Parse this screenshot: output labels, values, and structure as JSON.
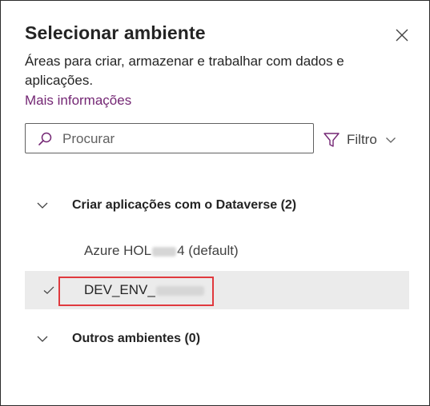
{
  "dialog": {
    "title": "Selecionar ambiente",
    "description": "Áreas para criar, armazenar e trabalhar com dados e aplicações.",
    "more_info_link": "Mais informações",
    "close_icon": "close-icon"
  },
  "search": {
    "placeholder": "Procurar",
    "value": "",
    "icon": "search-icon"
  },
  "filter": {
    "label": "Filtro",
    "icon": "filter-icon"
  },
  "groups": [
    {
      "label": "Criar aplicações com o Dataverse (2)",
      "expanded": true,
      "items": [
        {
          "name_prefix": "Azure HOL",
          "name_suffix": "4 (default)",
          "selected": false
        },
        {
          "name_prefix": "DEV_ENV_",
          "name_suffix": "",
          "selected": true
        }
      ]
    },
    {
      "label": "Outros ambientes (0)",
      "expanded": true,
      "items": []
    }
  ],
  "colors": {
    "link": "#742774",
    "selected_bg": "#ebebeb",
    "highlight_border": "#e0393e",
    "text": "#242424"
  }
}
